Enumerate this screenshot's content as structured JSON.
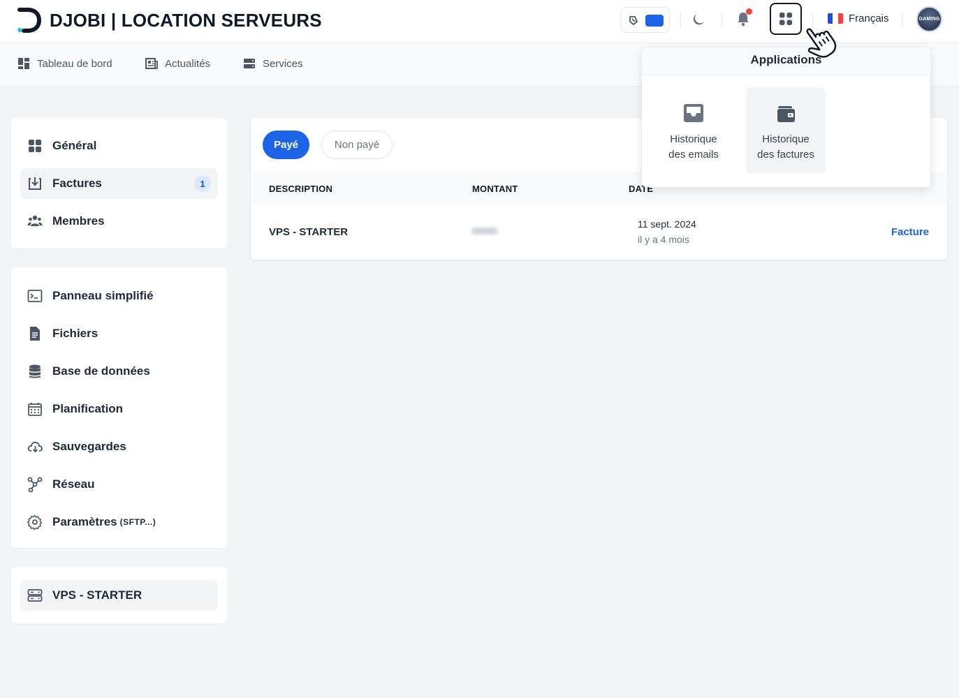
{
  "header": {
    "brand": "DJOBI | LOCATION SERVEURS",
    "language": "Français",
    "avatar_text": "GAMING",
    "accent_color": "#1d63e8"
  },
  "navbar": {
    "items": [
      {
        "label": "Tableau de bord",
        "icon": "dashboard-icon"
      },
      {
        "label": "Actualités",
        "icon": "newspaper-icon"
      },
      {
        "label": "Services",
        "icon": "server-icon"
      }
    ]
  },
  "sidebar": {
    "group1": [
      {
        "label": "Général",
        "icon": "grid-icon"
      },
      {
        "label": "Factures",
        "icon": "invoice-download-icon",
        "badge": "1"
      },
      {
        "label": "Membres",
        "icon": "users-icon"
      }
    ],
    "group2": [
      {
        "label": "Panneau simplifié",
        "icon": "terminal-icon"
      },
      {
        "label": "Fichiers",
        "icon": "file-icon"
      },
      {
        "label": "Base de données",
        "icon": "database-icon"
      },
      {
        "label": "Planification",
        "icon": "calendar-icon"
      },
      {
        "label": "Sauvegardes",
        "icon": "cloud-backup-icon"
      },
      {
        "label": "Réseau",
        "icon": "network-icon"
      },
      {
        "label": "Paramètres",
        "suffix": "(SFTP...)",
        "icon": "gear-icon"
      }
    ],
    "server": {
      "label": "VPS - STARTER",
      "icon": "server-icon"
    }
  },
  "invoices": {
    "filters": {
      "paid": "Payé",
      "unpaid": "Non payé"
    },
    "columns": {
      "description": "DESCRIPTION",
      "amount": "MONTANT",
      "date": "DATE"
    },
    "rows": [
      {
        "description": "VPS - STARTER",
        "date": "11 sept. 2024",
        "relative": "il y a 4 mois",
        "link": "Facture"
      }
    ]
  },
  "apps_menu": {
    "title": "Applications",
    "items": [
      {
        "line1": "Historique",
        "line2": "des emails",
        "icon": "inbox-icon"
      },
      {
        "line1": "Historique",
        "line2": "des factures",
        "icon": "wallet-icon"
      }
    ]
  }
}
